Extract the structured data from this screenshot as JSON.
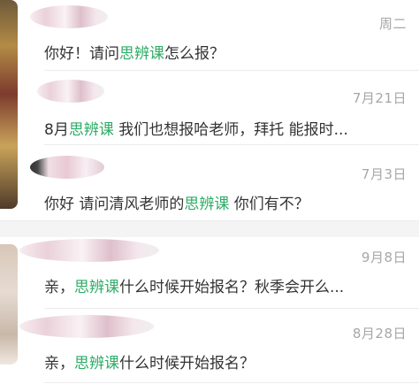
{
  "conversations": [
    {
      "date": "周二",
      "message_parts": [
        "你好！请问",
        "思辨课",
        "怎么报？"
      ]
    },
    {
      "date": "7月21日",
      "message_parts": [
        "8月",
        "思辨课",
        " 我们也想报哈老师，拜托 能报时..."
      ]
    },
    {
      "date": "7月3日",
      "message_parts": [
        "你好 请问清风老师的",
        "思辨课",
        " 你们有不？"
      ]
    },
    {
      "date": "9月8日",
      "message_parts": [
        "亲，",
        "思辨课",
        "什么时候开始报名？秋季会开么..."
      ]
    },
    {
      "date": "8月28日",
      "message_parts": [
        "亲，",
        "思辨课",
        "什么时候开始报名？"
      ]
    }
  ],
  "colors": {
    "keyword": "#2eac66",
    "text": "#333333",
    "date": "#a7a7a7",
    "divider": "#ececec"
  }
}
